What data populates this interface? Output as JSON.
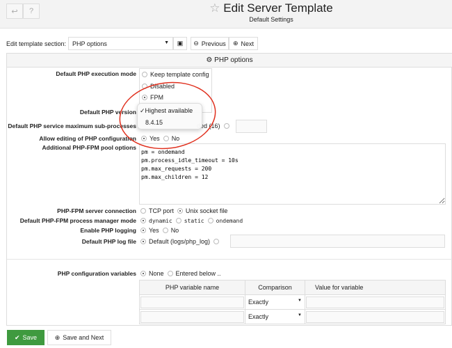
{
  "header": {
    "title": "Edit Server Template",
    "subtitle": "Default Settings",
    "back_icon": "return-arrow-icon",
    "help_icon": "question-icon",
    "star_icon": "star-outline-icon"
  },
  "toolbar": {
    "section_label": "Edit template section:",
    "section_value": "PHP options",
    "previous": "Previous",
    "next": "Next"
  },
  "panel": {
    "title": "PHP options",
    "icon": "gear-icon"
  },
  "form": {
    "exec_mode": {
      "label": "Default PHP execution mode",
      "options": [
        "Keep template config",
        "Disabled",
        "FPM"
      ],
      "selected": "FPM"
    },
    "php_version": {
      "label": "Default PHP version",
      "dropdown_options": [
        "Highest available",
        "8.4.15"
      ],
      "selected": "Highest available"
    },
    "subprocesses": {
      "label": "Default PHP service maximum sub-processes",
      "visible_option": "ded (16)",
      "value": ""
    },
    "allow_edit": {
      "label": "Allow editing of PHP configuration",
      "options": [
        "Yes",
        "No"
      ],
      "selected": "Yes"
    },
    "pool_options": {
      "label": "Additional PHP-FPM pool options",
      "value": "pm = ondemand\npm.process_idle_timeout = 10s\npm.max_requests = 200\npm.max_children = 12"
    },
    "connection": {
      "label": "PHP-FPM server connection",
      "options": [
        "TCP port",
        "Unix socket file"
      ],
      "selected": "Unix socket file"
    },
    "pm_mode": {
      "label": "Default PHP-FPM process manager mode",
      "options": [
        "dynamic",
        "static",
        "ondemand"
      ],
      "selected": "dynamic"
    },
    "logging": {
      "label": "Enable PHP logging",
      "options": [
        "Yes",
        "No"
      ],
      "selected": "Yes"
    },
    "log_file": {
      "label": "Default PHP log file",
      "default_option": "Default (logs/php_log)",
      "value": ""
    },
    "config_vars": {
      "label": "PHP configuration variables",
      "options": [
        "None",
        "Entered below .."
      ],
      "selected": "None",
      "columns": [
        "PHP variable name",
        "Comparison",
        "Value for variable"
      ],
      "rows": [
        {
          "name": "",
          "comparison": "Exactly",
          "value": ""
        },
        {
          "name": "",
          "comparison": "Exactly",
          "value": ""
        }
      ]
    }
  },
  "footer": {
    "save": "Save",
    "save_next": "Save and Next"
  },
  "colors": {
    "save_green": "#3f9a3f",
    "annotation_red": "#e0301e"
  }
}
